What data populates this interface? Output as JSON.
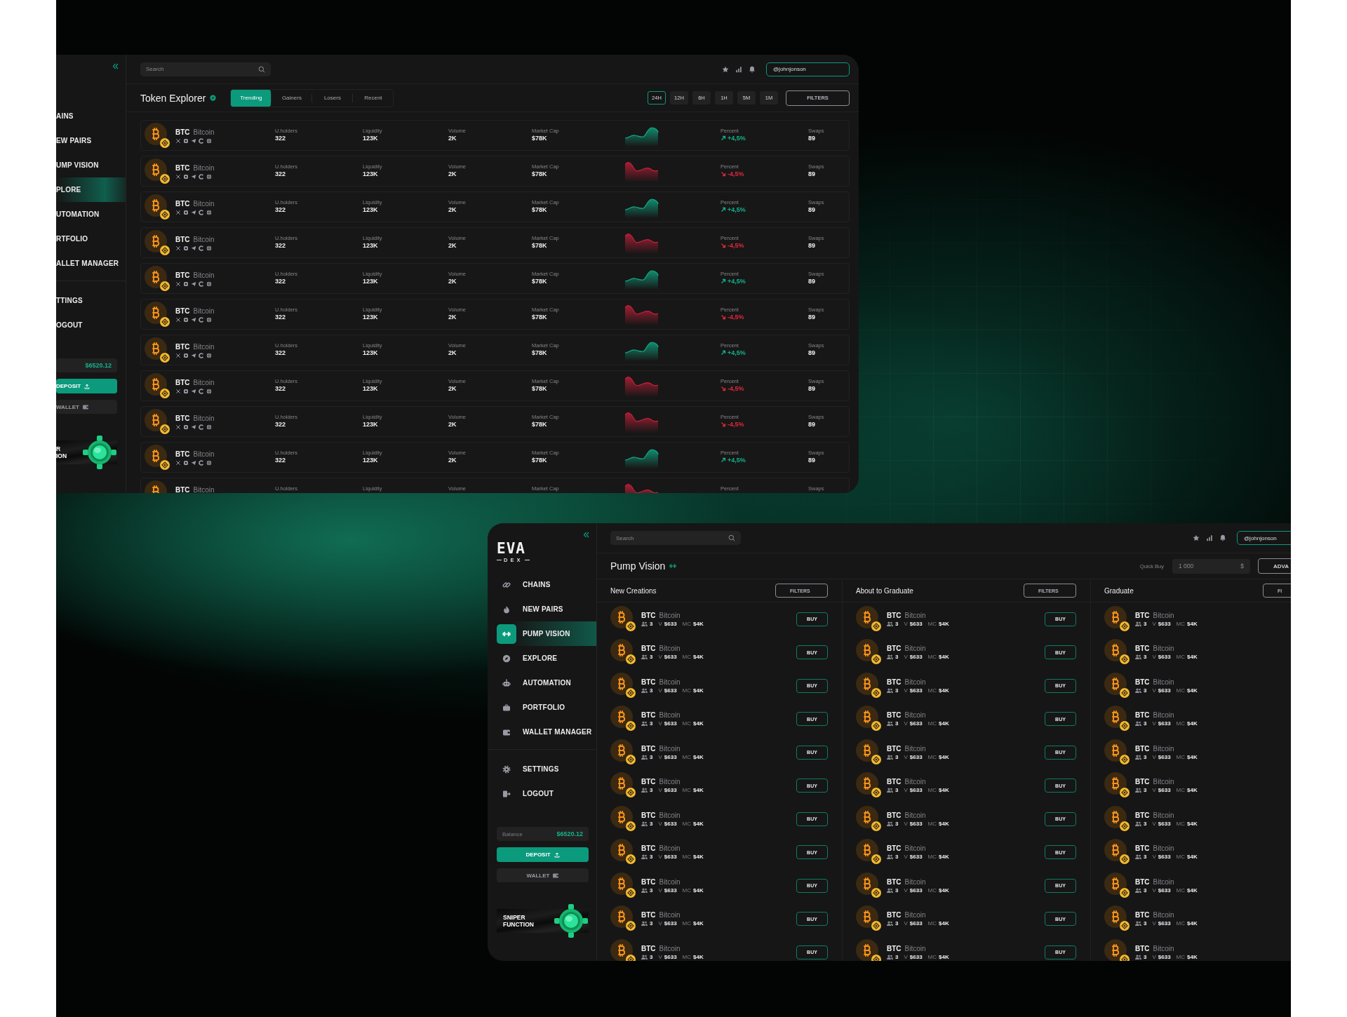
{
  "explorer_window": {
    "sidebar": {
      "items": [
        {
          "label": "AINS",
          "selected": false
        },
        {
          "label": "EW PAIRS",
          "selected": false
        },
        {
          "label": "UMP VISION",
          "selected": false
        },
        {
          "label": "PLORE",
          "selected": true
        },
        {
          "label": "UTOMATION",
          "selected": false
        },
        {
          "label": "RTFOLIO",
          "selected": false
        },
        {
          "label": "ALLET MANAGER",
          "selected": false
        }
      ],
      "bottom_items": [
        {
          "label": "TTINGS"
        },
        {
          "label": "OGOUT"
        }
      ],
      "balance": {
        "value": "$6520.12"
      },
      "deposit": "DEPOSIT",
      "wallet": "WALLET",
      "sniper": [
        "R",
        "ION"
      ]
    },
    "search": {
      "placeholder": "Search"
    },
    "username": "@johnjonson",
    "title": "Token Explorer",
    "tabs": [
      {
        "label": "Trending",
        "selected": true
      },
      {
        "label": "Gainers",
        "selected": false
      },
      {
        "label": "Losers",
        "selected": false
      },
      {
        "label": "Recent",
        "selected": false
      }
    ],
    "ranges": [
      {
        "label": "24H",
        "selected": true
      },
      {
        "label": "12H",
        "selected": false
      },
      {
        "label": "6H",
        "selected": false
      },
      {
        "label": "1H",
        "selected": false
      },
      {
        "label": "5M",
        "selected": false
      },
      {
        "label": "1M",
        "selected": false
      }
    ],
    "filters": "FILTERS",
    "rows": [
      {
        "symbol": "BTC",
        "name": "Bitcoin",
        "stats": [
          {
            "label": "U.holders",
            "value": "322"
          },
          {
            "label": "Liquidity",
            "value": "123K"
          },
          {
            "label": "Volume",
            "value": "2K"
          },
          {
            "label": "Market Cap",
            "value": "$78K"
          }
        ],
        "kind": "up",
        "percent": {
          "label": "Percent",
          "value": "+4,5%"
        },
        "swaps": {
          "label": "Swaps",
          "value": "89"
        }
      },
      {
        "symbol": "BTC",
        "name": "Bitcoin",
        "stats": [
          {
            "label": "U.holders",
            "value": "322"
          },
          {
            "label": "Liquidity",
            "value": "123K"
          },
          {
            "label": "Volume",
            "value": "2K"
          },
          {
            "label": "Market Cap",
            "value": "$78K"
          }
        ],
        "kind": "down",
        "percent": {
          "label": "Percent",
          "value": "-4,5%"
        },
        "swaps": {
          "label": "Swaps",
          "value": "89"
        }
      },
      {
        "symbol": "BTC",
        "name": "Bitcoin",
        "stats": [
          {
            "label": "U.holders",
            "value": "322"
          },
          {
            "label": "Liquidity",
            "value": "123K"
          },
          {
            "label": "Volume",
            "value": "2K"
          },
          {
            "label": "Market Cap",
            "value": "$78K"
          }
        ],
        "kind": "up",
        "percent": {
          "label": "Percent",
          "value": "+4,5%"
        },
        "swaps": {
          "label": "Swaps",
          "value": "89"
        }
      },
      {
        "symbol": "BTC",
        "name": "Bitcoin",
        "stats": [
          {
            "label": "U.holders",
            "value": "322"
          },
          {
            "label": "Liquidity",
            "value": "123K"
          },
          {
            "label": "Volume",
            "value": "2K"
          },
          {
            "label": "Market Cap",
            "value": "$78K"
          }
        ],
        "kind": "down",
        "percent": {
          "label": "Percent",
          "value": "-4,5%"
        },
        "swaps": {
          "label": "Swaps",
          "value": "89"
        }
      },
      {
        "symbol": "BTC",
        "name": "Bitcoin",
        "stats": [
          {
            "label": "U.holders",
            "value": "322"
          },
          {
            "label": "Liquidity",
            "value": "123K"
          },
          {
            "label": "Volume",
            "value": "2K"
          },
          {
            "label": "Market Cap",
            "value": "$78K"
          }
        ],
        "kind": "up",
        "percent": {
          "label": "Percent",
          "value": "+4,5%"
        },
        "swaps": {
          "label": "Swaps",
          "value": "89"
        }
      },
      {
        "symbol": "BTC",
        "name": "Bitcoin",
        "stats": [
          {
            "label": "U.holders",
            "value": "322"
          },
          {
            "label": "Liquidity",
            "value": "123K"
          },
          {
            "label": "Volume",
            "value": "2K"
          },
          {
            "label": "Market Cap",
            "value": "$78K"
          }
        ],
        "kind": "down",
        "percent": {
          "label": "Percent",
          "value": "-4,5%"
        },
        "swaps": {
          "label": "Swaps",
          "value": "89"
        }
      },
      {
        "symbol": "BTC",
        "name": "Bitcoin",
        "stats": [
          {
            "label": "U.holders",
            "value": "322"
          },
          {
            "label": "Liquidity",
            "value": "123K"
          },
          {
            "label": "Volume",
            "value": "2K"
          },
          {
            "label": "Market Cap",
            "value": "$78K"
          }
        ],
        "kind": "up",
        "percent": {
          "label": "Percent",
          "value": "+4,5%"
        },
        "swaps": {
          "label": "Swaps",
          "value": "89"
        }
      },
      {
        "symbol": "BTC",
        "name": "Bitcoin",
        "stats": [
          {
            "label": "U.holders",
            "value": "322"
          },
          {
            "label": "Liquidity",
            "value": "123K"
          },
          {
            "label": "Volume",
            "value": "2K"
          },
          {
            "label": "Market Cap",
            "value": "$78K"
          }
        ],
        "kind": "down",
        "percent": {
          "label": "Percent",
          "value": "-4,5%"
        },
        "swaps": {
          "label": "Swaps",
          "value": "89"
        }
      },
      {
        "symbol": "BTC",
        "name": "Bitcoin",
        "stats": [
          {
            "label": "U.holders",
            "value": "322"
          },
          {
            "label": "Liquidity",
            "value": "123K"
          },
          {
            "label": "Volume",
            "value": "2K"
          },
          {
            "label": "Market Cap",
            "value": "$78K"
          }
        ],
        "kind": "down",
        "percent": {
          "label": "Percent",
          "value": "-4,5%"
        },
        "swaps": {
          "label": "Swaps",
          "value": "89"
        }
      },
      {
        "symbol": "BTC",
        "name": "Bitcoin",
        "stats": [
          {
            "label": "U.holders",
            "value": "322"
          },
          {
            "label": "Liquidity",
            "value": "123K"
          },
          {
            "label": "Volume",
            "value": "2K"
          },
          {
            "label": "Market Cap",
            "value": "$78K"
          }
        ],
        "kind": "up",
        "percent": {
          "label": "Percent",
          "value": "+4,5%"
        },
        "swaps": {
          "label": "Swaps",
          "value": "89"
        }
      },
      {
        "symbol": "BTC",
        "name": "Bitcoin",
        "stats": [
          {
            "label": "U.holders"
          },
          {
            "label": "Liquidity"
          },
          {
            "label": "Volume"
          },
          {
            "label": "Market Cap"
          }
        ],
        "kind": "down",
        "percent": {
          "label": "Percent"
        },
        "swaps": {
          "label": "Swaps"
        }
      }
    ]
  },
  "pump_window": {
    "sidebar": {
      "logo": "EVA",
      "logo_sub": "DEX",
      "items": [
        {
          "label": "CHAINS",
          "selected": false
        },
        {
          "label": "NEW PAIRS",
          "selected": false
        },
        {
          "label": "PUMP VISION",
          "selected": true
        },
        {
          "label": "EXPLORE",
          "selected": false
        },
        {
          "label": "AUTOMATION",
          "selected": false
        },
        {
          "label": "PORTFOLIO",
          "selected": false
        },
        {
          "label": "WALLET MANAGER",
          "selected": false
        }
      ],
      "bottom_items": [
        {
          "label": "SETTINGS"
        },
        {
          "label": "LOGOUT"
        }
      ],
      "balance": {
        "label": "Balance",
        "value": "$6520.12"
      },
      "deposit": "DEPOSIT",
      "wallet": "WALLET",
      "sniper": [
        "SNIPER",
        "FUNCTION"
      ]
    },
    "search": {
      "placeholder": "Search"
    },
    "username": "@johnjonson",
    "title": "Pump Vision",
    "quick_buy": {
      "label": "Quick Buy",
      "placeholder": "1 000",
      "currency": "$"
    },
    "advanced": "ADVA",
    "columns": [
      {
        "title": "New Creations",
        "filters": "FILTERS",
        "rows": [
          {
            "symbol": "BTC",
            "name": "Bitcoin",
            "holders": "3",
            "volume_label": "V",
            "volume": "$633",
            "mc_label": "MC",
            "mc": "$4K",
            "buy": "BUY"
          },
          {
            "symbol": "BTC",
            "name": "Bitcoin",
            "holders": "3",
            "volume_label": "V",
            "volume": "$633",
            "mc_label": "MC",
            "mc": "$4K",
            "buy": "BUY"
          },
          {
            "symbol": "BTC",
            "name": "Bitcoin",
            "holders": "3",
            "volume_label": "V",
            "volume": "$633",
            "mc_label": "MC",
            "mc": "$4K",
            "buy": "BUY"
          },
          {
            "symbol": "BTC",
            "name": "Bitcoin",
            "holders": "3",
            "volume_label": "V",
            "volume": "$633",
            "mc_label": "MC",
            "mc": "$4K",
            "buy": "BUY"
          },
          {
            "symbol": "BTC",
            "name": "Bitcoin",
            "holders": "3",
            "volume_label": "V",
            "volume": "$633",
            "mc_label": "MC",
            "mc": "$4K",
            "buy": "BUY"
          },
          {
            "symbol": "BTC",
            "name": "Bitcoin",
            "holders": "3",
            "volume_label": "V",
            "volume": "$633",
            "mc_label": "MC",
            "mc": "$4K",
            "buy": "BUY"
          },
          {
            "symbol": "BTC",
            "name": "Bitcoin",
            "holders": "3",
            "volume_label": "V",
            "volume": "$633",
            "mc_label": "MC",
            "mc": "$4K",
            "buy": "BUY"
          },
          {
            "symbol": "BTC",
            "name": "Bitcoin",
            "holders": "3",
            "volume_label": "V",
            "volume": "$633",
            "mc_label": "MC",
            "mc": "$4K",
            "buy": "BUY"
          },
          {
            "symbol": "BTC",
            "name": "Bitcoin",
            "holders": "3",
            "volume_label": "V",
            "volume": "$633",
            "mc_label": "MC",
            "mc": "$4K",
            "buy": "BUY"
          },
          {
            "symbol": "BTC",
            "name": "Bitcoin",
            "holders": "3",
            "volume_label": "V",
            "volume": "$633",
            "mc_label": "MC",
            "mc": "$4K",
            "buy": "BUY"
          },
          {
            "symbol": "BTC",
            "name": "Bitcoin",
            "holders": "3",
            "volume_label": "V",
            "volume": "$633",
            "mc_label": "MC",
            "mc": "$4K",
            "buy": "BUY"
          }
        ]
      },
      {
        "title": "About to Graduate",
        "filters": "FILTERS",
        "rows": [
          {
            "symbol": "BTC",
            "name": "Bitcoin",
            "holders": "3",
            "volume_label": "V",
            "volume": "$633",
            "mc_label": "MC",
            "mc": "$4K",
            "buy": "BUY"
          },
          {
            "symbol": "BTC",
            "name": "Bitcoin",
            "holders": "3",
            "volume_label": "V",
            "volume": "$633",
            "mc_label": "MC",
            "mc": "$4K",
            "buy": "BUY"
          },
          {
            "symbol": "BTC",
            "name": "Bitcoin",
            "holders": "3",
            "volume_label": "V",
            "volume": "$633",
            "mc_label": "MC",
            "mc": "$4K",
            "buy": "BUY"
          },
          {
            "symbol": "BTC",
            "name": "Bitcoin",
            "holders": "3",
            "volume_label": "V",
            "volume": "$633",
            "mc_label": "MC",
            "mc": "$4K",
            "buy": "BUY"
          },
          {
            "symbol": "BTC",
            "name": "Bitcoin",
            "holders": "3",
            "volume_label": "V",
            "volume": "$633",
            "mc_label": "MC",
            "mc": "$4K",
            "buy": "BUY"
          },
          {
            "symbol": "BTC",
            "name": "Bitcoin",
            "holders": "3",
            "volume_label": "V",
            "volume": "$633",
            "mc_label": "MC",
            "mc": "$4K",
            "buy": "BUY"
          },
          {
            "symbol": "BTC",
            "name": "Bitcoin",
            "holders": "3",
            "volume_label": "V",
            "volume": "$633",
            "mc_label": "MC",
            "mc": "$4K",
            "buy": "BUY"
          },
          {
            "symbol": "BTC",
            "name": "Bitcoin",
            "holders": "3",
            "volume_label": "V",
            "volume": "$633",
            "mc_label": "MC",
            "mc": "$4K",
            "buy": "BUY"
          },
          {
            "symbol": "BTC",
            "name": "Bitcoin",
            "holders": "3",
            "volume_label": "V",
            "volume": "$633",
            "mc_label": "MC",
            "mc": "$4K",
            "buy": "BUY"
          },
          {
            "symbol": "BTC",
            "name": "Bitcoin",
            "holders": "3",
            "volume_label": "V",
            "volume": "$633",
            "mc_label": "MC",
            "mc": "$4K",
            "buy": "BUY"
          },
          {
            "symbol": "BTC",
            "name": "Bitcoin",
            "holders": "3",
            "volume_label": "V",
            "volume": "$633",
            "mc_label": "MC",
            "mc": "$4K",
            "buy": "BUY"
          }
        ]
      },
      {
        "title": "Graduate",
        "filters": "FI",
        "rows": [
          {
            "symbol": "BTC",
            "name": "Bitcoin",
            "holders": "3",
            "volume_label": "V",
            "volume": "$633",
            "mc_label": "MC",
            "mc": "$4K"
          },
          {
            "symbol": "BTC",
            "name": "Bitcoin",
            "holders": "3",
            "volume_label": "V",
            "volume": "$633",
            "mc_label": "MC",
            "mc": "$4K"
          },
          {
            "symbol": "BTC",
            "name": "Bitcoin",
            "holders": "3",
            "volume_label": "V",
            "volume": "$633",
            "mc_label": "MC",
            "mc": "$4K"
          },
          {
            "symbol": "BTC",
            "name": "Bitcoin",
            "holders": "3",
            "volume_label": "V",
            "volume": "$633",
            "mc_label": "MC",
            "mc": "$4K"
          },
          {
            "symbol": "BTC",
            "name": "Bitcoin",
            "holders": "3",
            "volume_label": "V",
            "volume": "$633",
            "mc_label": "MC",
            "mc": "$4K"
          },
          {
            "symbol": "BTC",
            "name": "Bitcoin",
            "holders": "3",
            "volume_label": "V",
            "volume": "$633",
            "mc_label": "MC",
            "mc": "$4K"
          },
          {
            "symbol": "BTC",
            "name": "Bitcoin",
            "holders": "3",
            "volume_label": "V",
            "volume": "$633",
            "mc_label": "MC",
            "mc": "$4K"
          },
          {
            "symbol": "BTC",
            "name": "Bitcoin",
            "holders": "3",
            "volume_label": "V",
            "volume": "$633",
            "mc_label": "MC",
            "mc": "$4K"
          },
          {
            "symbol": "BTC",
            "name": "Bitcoin",
            "holders": "3",
            "volume_label": "V",
            "volume": "$633",
            "mc_label": "MC",
            "mc": "$4K"
          },
          {
            "symbol": "BTC",
            "name": "Bitcoin",
            "holders": "3",
            "volume_label": "V",
            "volume": "$633",
            "mc_label": "MC",
            "mc": "$4K"
          },
          {
            "symbol": "BTC",
            "name": "Bitcoin",
            "holders": "3",
            "volume_label": "V",
            "volume": "$633",
            "mc_label": "MC",
            "mc": "$4K"
          }
        ]
      }
    ]
  }
}
